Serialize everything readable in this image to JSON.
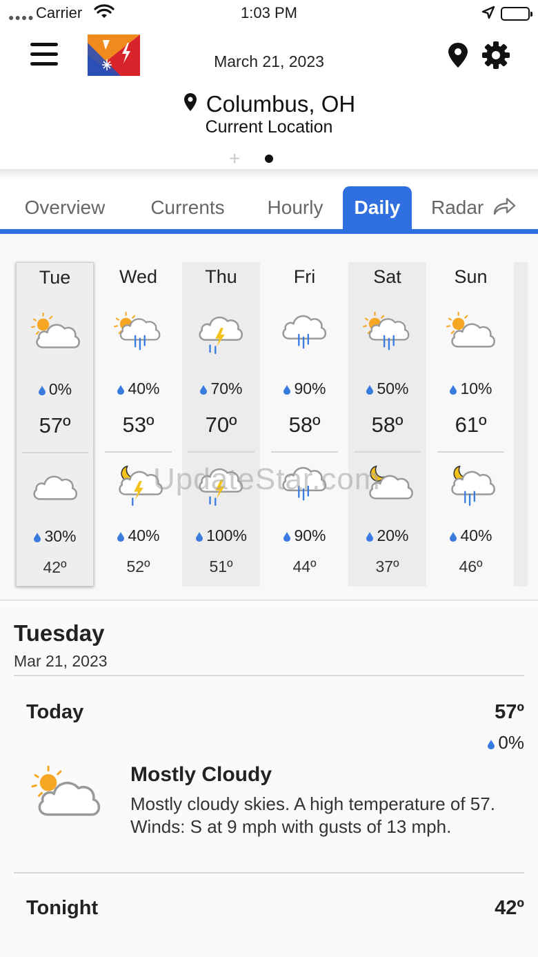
{
  "status_bar": {
    "carrier": "Carrier",
    "time": "1:03 PM"
  },
  "header": {
    "date": "March 21, 2023",
    "city": "Columbus, OH",
    "location_label": "Current Location"
  },
  "tabs": [
    {
      "label": "Overview",
      "active": false
    },
    {
      "label": "Currents",
      "active": false
    },
    {
      "label": "Hourly",
      "active": false
    },
    {
      "label": "Daily",
      "active": true
    },
    {
      "label": "Radar",
      "active": false
    }
  ],
  "days": [
    {
      "name": "Tue",
      "day_icon": "partly-cloudy-day",
      "day_precip": "0%",
      "high": "57º",
      "night_icon": "cloudy",
      "night_precip": "30%",
      "low": "42º"
    },
    {
      "name": "Wed",
      "day_icon": "partly-cloudy-rain-day",
      "day_precip": "40%",
      "high": "53º",
      "night_icon": "thunderstorm-night",
      "night_precip": "40%",
      "low": "52º"
    },
    {
      "name": "Thu",
      "day_icon": "thunderstorm",
      "day_precip": "70%",
      "high": "70º",
      "night_icon": "thunderstorm",
      "night_precip": "100%",
      "low": "51º"
    },
    {
      "name": "Fri",
      "day_icon": "rain",
      "day_precip": "90%",
      "high": "58º",
      "night_icon": "rain",
      "night_precip": "90%",
      "low": "44º"
    },
    {
      "name": "Sat",
      "day_icon": "partly-cloudy-rain-day",
      "day_precip": "50%",
      "high": "58º",
      "night_icon": "partly-cloudy-night",
      "night_precip": "20%",
      "low": "37º"
    },
    {
      "name": "Sun",
      "day_icon": "partly-cloudy-day",
      "day_precip": "10%",
      "high": "61º",
      "night_icon": "rain-night",
      "night_precip": "40%",
      "low": "46º"
    }
  ],
  "watermark": "UpdateStar.com",
  "details": {
    "day_name": "Tuesday",
    "date": "Mar 21, 2023",
    "today": {
      "label": "Today",
      "high": "57º",
      "precip": "0%",
      "condition": "Mostly Cloudy",
      "description": "Mostly cloudy skies. A high temperature of 57. Winds: S at 9 mph with gusts of 13 mph."
    },
    "tonight": {
      "label": "Tonight",
      "low": "42º"
    }
  },
  "colors": {
    "accent": "#2f6fe0",
    "sun": "#f5a623",
    "rain": "#3a7be0"
  }
}
